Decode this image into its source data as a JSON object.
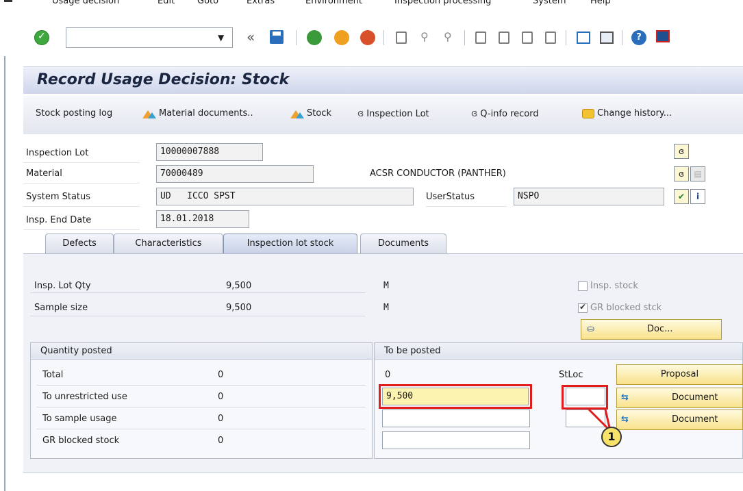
{
  "menu": {
    "items": [
      "Usage decision",
      "Edit",
      "Goto",
      "Extras",
      "Environment",
      "Inspection processing",
      "System",
      "Help"
    ]
  },
  "toolbar": {
    "command_field": "",
    "icons": [
      "enter-icon",
      "back-icon",
      "save-icon",
      "back-green-icon",
      "exit-icon",
      "cancel-icon",
      "print-icon",
      "find-icon",
      "find-next-icon",
      "first-page-icon",
      "prev-page-icon",
      "next-page-icon",
      "last-page-icon",
      "new-session-icon",
      "shortcut-icon",
      "help-icon",
      "customize-icon"
    ]
  },
  "title": "Record Usage Decision: Stock",
  "app_toolbar": {
    "stock_posting_log": "Stock posting log",
    "material_documents": "Material documents..",
    "stock": "Stock",
    "inspection_lot": "Inspection Lot",
    "q_info_record": "Q-info record",
    "change_history": "Change history..."
  },
  "header": {
    "inspection_lot_label": "Inspection Lot",
    "inspection_lot_value": "10000007888",
    "material_label": "Material",
    "material_value": "70000489",
    "material_desc": "ACSR CONDUCTOR (PANTHER)",
    "system_status_label": "System Status",
    "system_status_value": "UD   ICCO SPST",
    "user_status_label": "UserStatus",
    "user_status_value": "NSPO",
    "insp_end_date_label": "Insp. End Date",
    "insp_end_date_value": "18.01.2018"
  },
  "tabs": [
    "Defects",
    "Characteristics",
    "Inspection lot stock",
    "Documents"
  ],
  "active_tab": "Inspection lot stock",
  "stock": {
    "insp_lot_qty_label": "Insp. Lot Qty",
    "insp_lot_qty_value": "9,500",
    "insp_lot_qty_unit": "M",
    "sample_size_label": "Sample size",
    "sample_size_value": "9,500",
    "sample_size_unit": "M",
    "insp_stock_label": "Insp. stock",
    "insp_stock_checked": false,
    "gr_blocked_label": "GR blocked stck",
    "gr_blocked_checked": true,
    "doc_button": "Doc..."
  },
  "quantity_posted": {
    "title": "Quantity posted",
    "rows": [
      {
        "label": "Total",
        "value": "0"
      },
      {
        "label": "To unrestricted use",
        "value": "0"
      },
      {
        "label": "To sample usage",
        "value": "0"
      },
      {
        "label": "GR blocked stock",
        "value": "0"
      }
    ]
  },
  "to_be_posted": {
    "title": "To be posted",
    "total_value": "0",
    "stloc_label": "StLoc",
    "proposal_button": "Proposal",
    "unrestricted_value": "9,500",
    "sample_value": "",
    "gr_blocked_value": "",
    "document_button_1": "Document",
    "document_button_2": "Document"
  },
  "annotation": {
    "callout": "1"
  },
  "colors": {
    "title_bg": "#cfd5ec",
    "button_yellow": "#f8e28a",
    "highlight_red": "#e01c1c",
    "focus_field": "#fdf3b0"
  }
}
